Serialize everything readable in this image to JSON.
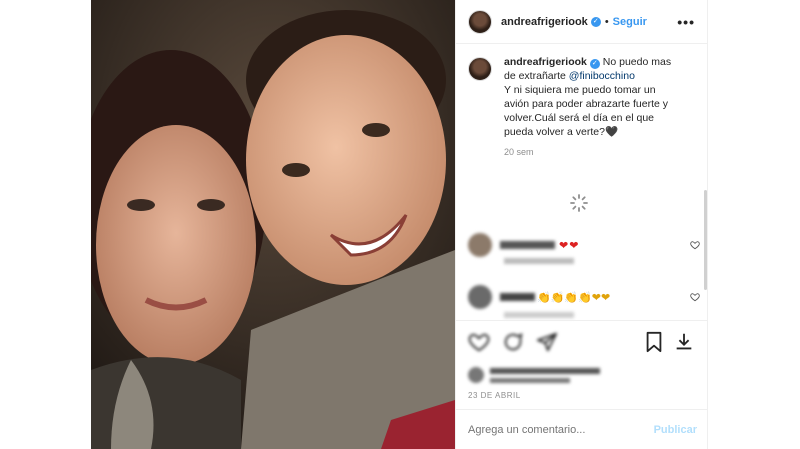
{
  "post": {
    "username": "andreafrigeriook",
    "follow_label": "Seguir",
    "more_label": "•••",
    "verified_mark": "✓",
    "caption": {
      "username": "andreafrigeriook",
      "text_before_mention": " No puedo mas de extrañarte ",
      "mention": "@finibocchino",
      "text_after": "Y ni siquiera me puedo tomar un avión para poder abrazarte fuerte y volver.Cuál será el día en el que pueda volver a verte?🖤",
      "time": "20 sem"
    },
    "comments": [
      {
        "emoji": "❤❤",
        "icon": "heart-outline-icon"
      },
      {
        "emoji": "👏👏👏👏❤❤",
        "icon": "heart-outline-icon"
      }
    ],
    "date": "23 DE ABRIL",
    "add_comment_placeholder": "Agrega un comentario...",
    "publish_label": "Publicar"
  },
  "icons": [
    "heart-icon",
    "comment-icon",
    "share-icon",
    "bookmark-icon"
  ],
  "colors": {
    "accent": "#3897f0",
    "text": "#262626",
    "muted": "#8e8e8e",
    "publish_disabled": "#b2dffc"
  }
}
